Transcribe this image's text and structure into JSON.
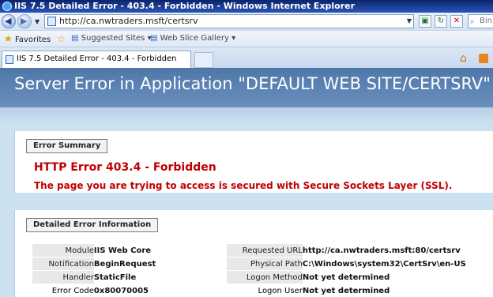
{
  "window": {
    "title": "IIS 7.5 Detailed Error - 403.4 - Forbidden - Windows Internet Explorer"
  },
  "address_bar": {
    "url": "http://ca.nwtraders.msft/certsrv",
    "search_placeholder": "Bin"
  },
  "favorites_bar": {
    "favorites_label": "Favorites",
    "items": [
      {
        "label": "Suggested Sites"
      },
      {
        "label": "Web Slice Gallery"
      }
    ]
  },
  "tabs": [
    {
      "label": "IIS 7.5 Detailed Error - 403.4 - Forbidden"
    }
  ],
  "page": {
    "header": "Server Error in Application \"DEFAULT WEB SITE/CERTSRV\"",
    "summary": {
      "legend": "Error Summary",
      "title": "HTTP Error 403.4 - Forbidden",
      "message": "The page you are trying to access is secured with Secure Sockets Layer (SSL)."
    },
    "details": {
      "legend": "Detailed Error Information",
      "rows": [
        {
          "label1": "Module",
          "value1": "IIS Web Core",
          "label2": "Requested URL",
          "value2": "http://ca.nwtraders.msft:80/certsrv"
        },
        {
          "label1": "Notification",
          "value1": "BeginRequest",
          "label2": "Physical Path",
          "value2": "C:\\Windows\\system32\\CertSrv\\en-US"
        },
        {
          "label1": "Handler",
          "value1": "StaticFile",
          "label2": "Logon Method",
          "value2": "Not yet determined"
        },
        {
          "label1": "Error Code",
          "value1": "0x80070005",
          "label2": "Logon User",
          "value2": "Not yet determined"
        }
      ]
    }
  },
  "icons": [
    "ie-icon",
    "back-icon",
    "forward-icon",
    "page-icon",
    "compatibility-icon",
    "refresh-icon",
    "stop-icon",
    "bing-icon",
    "favorites-star-icon",
    "add-favorites-icon",
    "suggested-sites-icon",
    "web-slice-icon",
    "tab-page-icon",
    "home-icon",
    "feeds-icon"
  ]
}
